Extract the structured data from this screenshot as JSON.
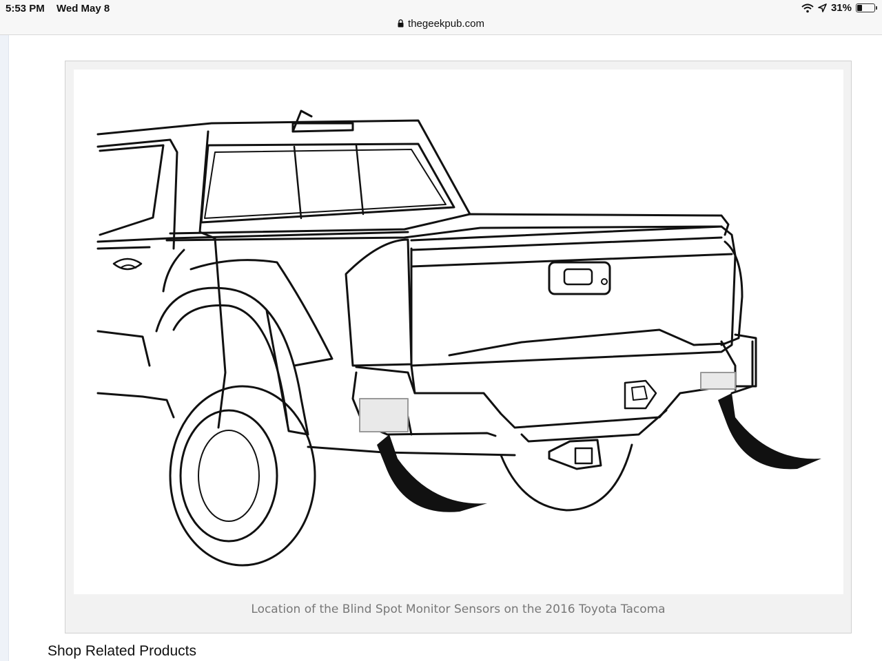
{
  "status_bar": {
    "time": "5:53 PM",
    "date": "Wed May 8",
    "battery_percent": "31%",
    "battery_level": 0.31,
    "icons": [
      "wifi-icon",
      "location-arrow-icon",
      "battery-icon"
    ]
  },
  "address_bar": {
    "lock_icon": "lock-icon",
    "url": "thegeekpub.com"
  },
  "figure": {
    "caption": "Location of the Blind Spot Monitor Sensors on the 2016 Toyota Tacoma",
    "illustration": "truck-rear-line-drawing"
  },
  "section": {
    "heading": "Shop Related Products"
  },
  "colors": {
    "line": "#111111",
    "caption": "#777777",
    "figure_bg": "#f2f2f2"
  }
}
